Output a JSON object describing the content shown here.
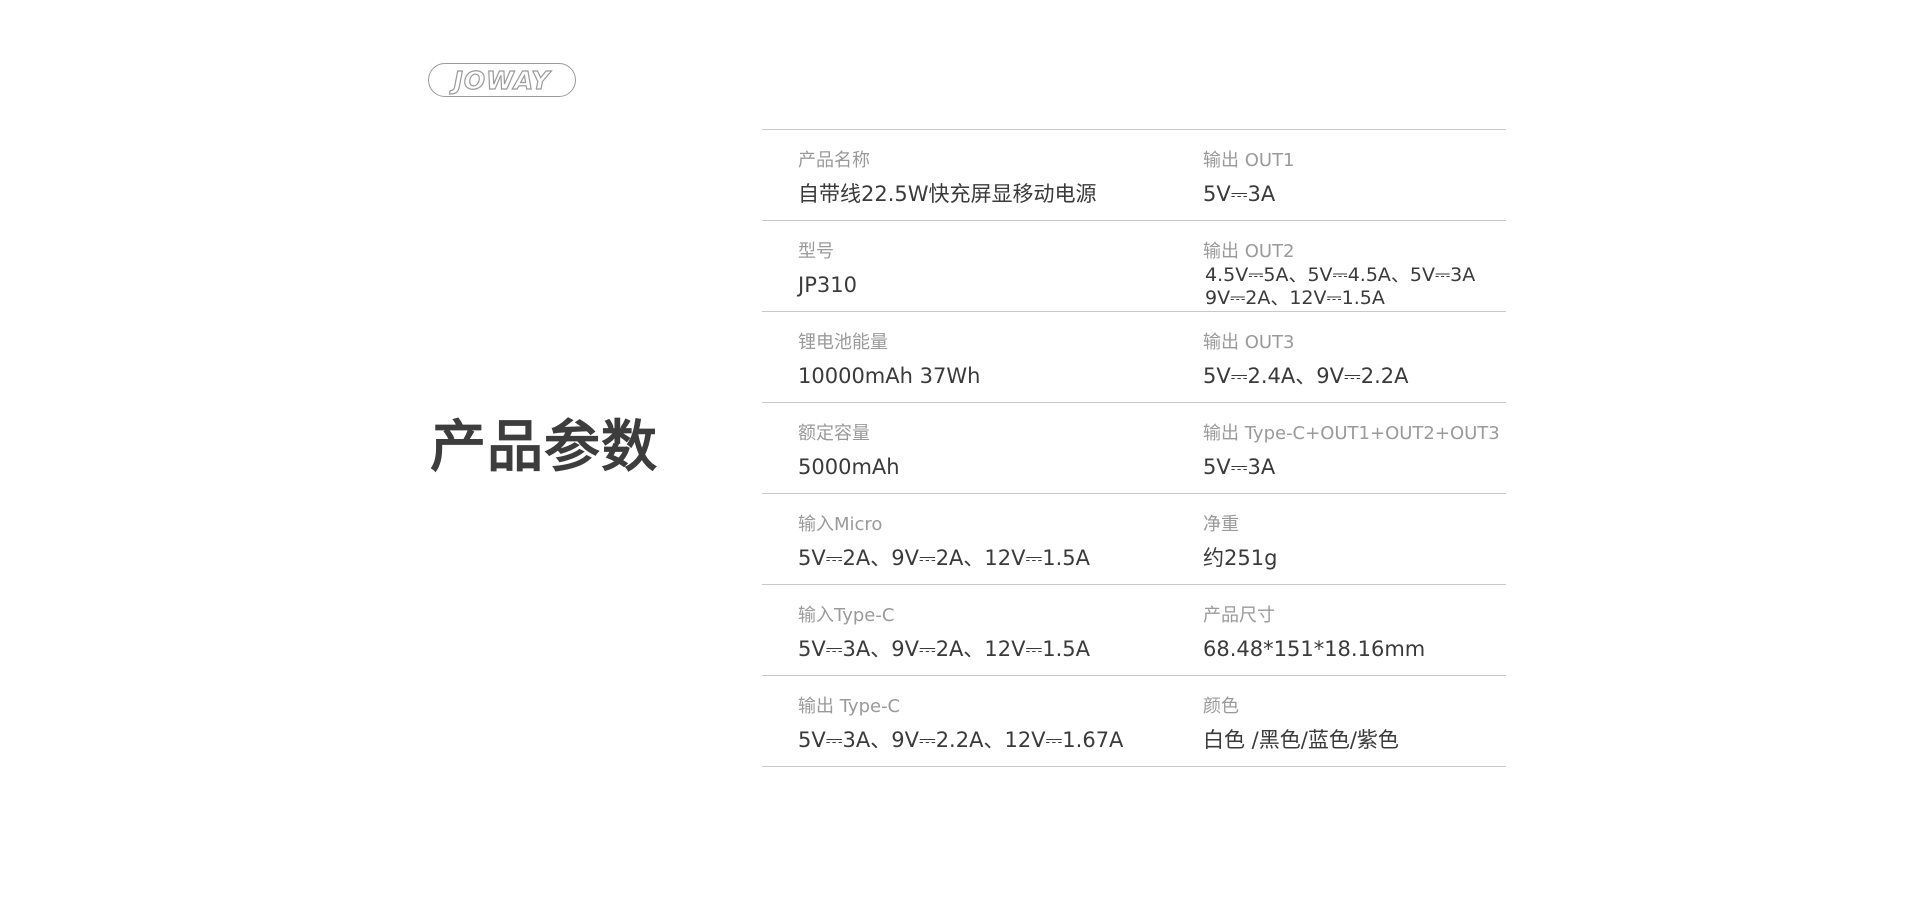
{
  "brand": {
    "logo_text": "JOWAY"
  },
  "page_title": "产品参数",
  "specs": {
    "rows": [
      {
        "left": {
          "label": "产品名称",
          "value": "自带线22.5W快充屏显移动电源"
        },
        "right": {
          "label": "输出 OUT1",
          "value": "5V⎓3A"
        }
      },
      {
        "left": {
          "label": "型号",
          "value": "JP310"
        },
        "right": {
          "label": "输出 OUT2",
          "value": "4.5V⎓5A、5V⎓4.5A、5V⎓3A\n9V⎓2A、12V⎓1.5A"
        }
      },
      {
        "left": {
          "label": "锂电池能量",
          "value": "10000mAh  37Wh"
        },
        "right": {
          "label": "输出 OUT3",
          "value": "5V⎓2.4A、9V⎓2.2A"
        }
      },
      {
        "left": {
          "label": "额定容量",
          "value": "5000mAh"
        },
        "right": {
          "label": "输出 Type-C+OUT1+OUT2+OUT3",
          "value": "5V⎓3A"
        }
      },
      {
        "left": {
          "label": "输入Micro",
          "value": "5V⎓2A、9V⎓2A、12V⎓1.5A"
        },
        "right": {
          "label": "净重",
          "value": "约251g"
        }
      },
      {
        "left": {
          "label": "输入Type-C",
          "value": "5V⎓3A、9V⎓2A、12V⎓1.5A"
        },
        "right": {
          "label": "产品尺寸",
          "value": "68.48*151*18.16mm"
        }
      },
      {
        "left": {
          "label": "输出 Type-C",
          "value": "5V⎓3A、9V⎓2.2A、12V⎓1.67A"
        },
        "right": {
          "label": "颜色",
          "value": "白色 /黑色/蓝色/紫色"
        }
      }
    ]
  }
}
